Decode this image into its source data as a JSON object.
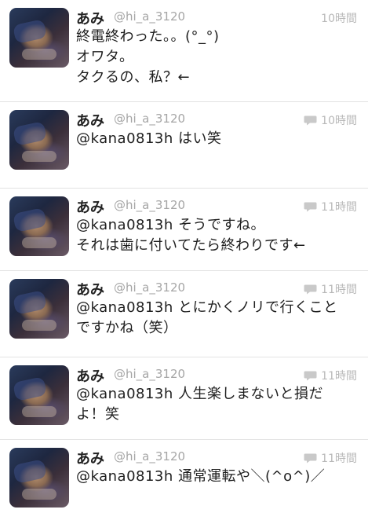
{
  "tweets": [
    {
      "name": "あみ",
      "handle": "@hi_a_3120",
      "time": "10時間",
      "reply_indicator": false,
      "lines": [
        "終電終わった。。(°_°)",
        "オワタ。",
        "タクるの、私？←"
      ]
    },
    {
      "name": "あみ",
      "handle": "@hi_a_3120",
      "time": "10時間",
      "reply_indicator": true,
      "lines": [
        "@kana0813h はい笑"
      ]
    },
    {
      "name": "あみ",
      "handle": "@hi_a_3120",
      "time": "11時間",
      "reply_indicator": true,
      "lines": [
        "@kana0813h そうですね。",
        "それは歯に付いてたら終わりです←"
      ]
    },
    {
      "name": "あみ",
      "handle": "@hi_a_3120",
      "time": "11時間",
      "reply_indicator": true,
      "lines": [
        "@kana0813h とにかくノリで行くこと",
        "ですかね（笑）"
      ]
    },
    {
      "name": "あみ",
      "handle": "@hi_a_3120",
      "time": "11時間",
      "reply_indicator": true,
      "lines": [
        "@kana0813h 人生楽しまないと損だ",
        "よ！笑"
      ]
    },
    {
      "name": "あみ",
      "handle": "@hi_a_3120",
      "time": "11時間",
      "reply_indicator": true,
      "lines": [
        "@kana0813h 通常運転や＼(^o^)／"
      ]
    }
  ],
  "icons": {
    "reply": "speech-bubble-icon"
  },
  "colors": {
    "name": "#222222",
    "handle": "#a6a6a6",
    "time": "#b8b8b8",
    "divider": "#e3e3e3"
  }
}
